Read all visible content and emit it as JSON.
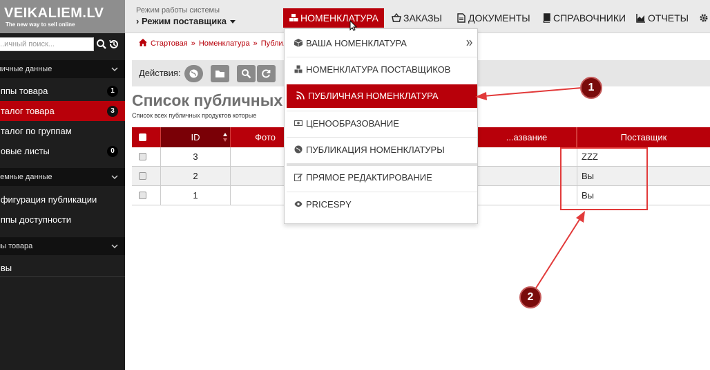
{
  "sidebar": {
    "logo_title": "VEIKALIEM.LV",
    "logo_tagline": "The new way to sell online",
    "search_placeholder": "...ичный поиск...",
    "sections": [
      {
        "label": "...личные данные"
      },
      {
        "label": "...темные данные"
      },
      {
        "label": "...пы товара"
      }
    ],
    "items": [
      {
        "label": "...ппы товара",
        "badge": "1"
      },
      {
        "label": "...талог товара",
        "badge": "3"
      },
      {
        "label": "...талог по группам"
      },
      {
        "label": "...овые листы",
        "badge": "0"
      },
      {
        "label": "...фигурация публикации"
      },
      {
        "label": "...ппы доступности"
      },
      {
        "label": "...вы"
      }
    ]
  },
  "topbar": {
    "mode_caption": "Режим работы системы",
    "mode_value": "› Режим поставщика",
    "nav": [
      {
        "label": "НОМЕНКЛАТУРА",
        "icon": "cubes-icon"
      },
      {
        "label": "ЗАКАЗЫ",
        "icon": "basket-icon"
      },
      {
        "label": "ДОКУМЕНТЫ",
        "icon": "document-icon"
      },
      {
        "label": "СПРАВОЧНИКИ",
        "icon": "book-icon"
      },
      {
        "label": "ОТЧЕТЫ",
        "icon": "area-chart-icon"
      }
    ]
  },
  "breadcrumb": {
    "items": [
      "Стартовая",
      "Номенклатура",
      "Публи..."
    ]
  },
  "actions": {
    "label": "Действия:"
  },
  "page": {
    "title": "Список публичных",
    "subtitle": "Список всех публичных продуктов которые"
  },
  "table": {
    "columns": {
      "id": "ID",
      "photo": "Фото",
      "name": "...азвание",
      "supplier": "Поставщик"
    },
    "rows": [
      {
        "id": "3",
        "supplier": "ZZZ"
      },
      {
        "id": "2",
        "supplier": "Вы"
      },
      {
        "id": "1",
        "supplier": "Вы"
      }
    ]
  },
  "dropdown": {
    "items": [
      {
        "label": "ВАША НОМЕНКЛАТУРА",
        "icon": "cube-icon"
      },
      {
        "label": "НОМЕНКЛАТУРА ПОСТАВЩИКОВ",
        "icon": "cubes-icon"
      },
      {
        "label": "ПУБЛИЧНАЯ НОМЕНКЛАТУРА",
        "icon": "rss-icon",
        "active": true
      },
      {
        "label": "ЦЕНООБРАЗОВАНИЕ",
        "icon": "money-icon"
      },
      {
        "label": "ПУБЛИКАЦИЯ НОМЕНКЛАТУРЫ",
        "icon": "globe-icon"
      },
      {
        "label": "ПРЯМОЕ РЕДАКТИРОВАНИЕ",
        "icon": "edit-icon"
      },
      {
        "label": "PRICESPY",
        "icon": "eye-icon"
      }
    ]
  },
  "annotations": {
    "marker_1": "1",
    "marker_2": "2",
    "color": "#e23a3a"
  },
  "colors": {
    "accent": "#b8000a",
    "sidebar_bg": "#1e1e1e",
    "topbar_bg": "#eaeaea"
  }
}
